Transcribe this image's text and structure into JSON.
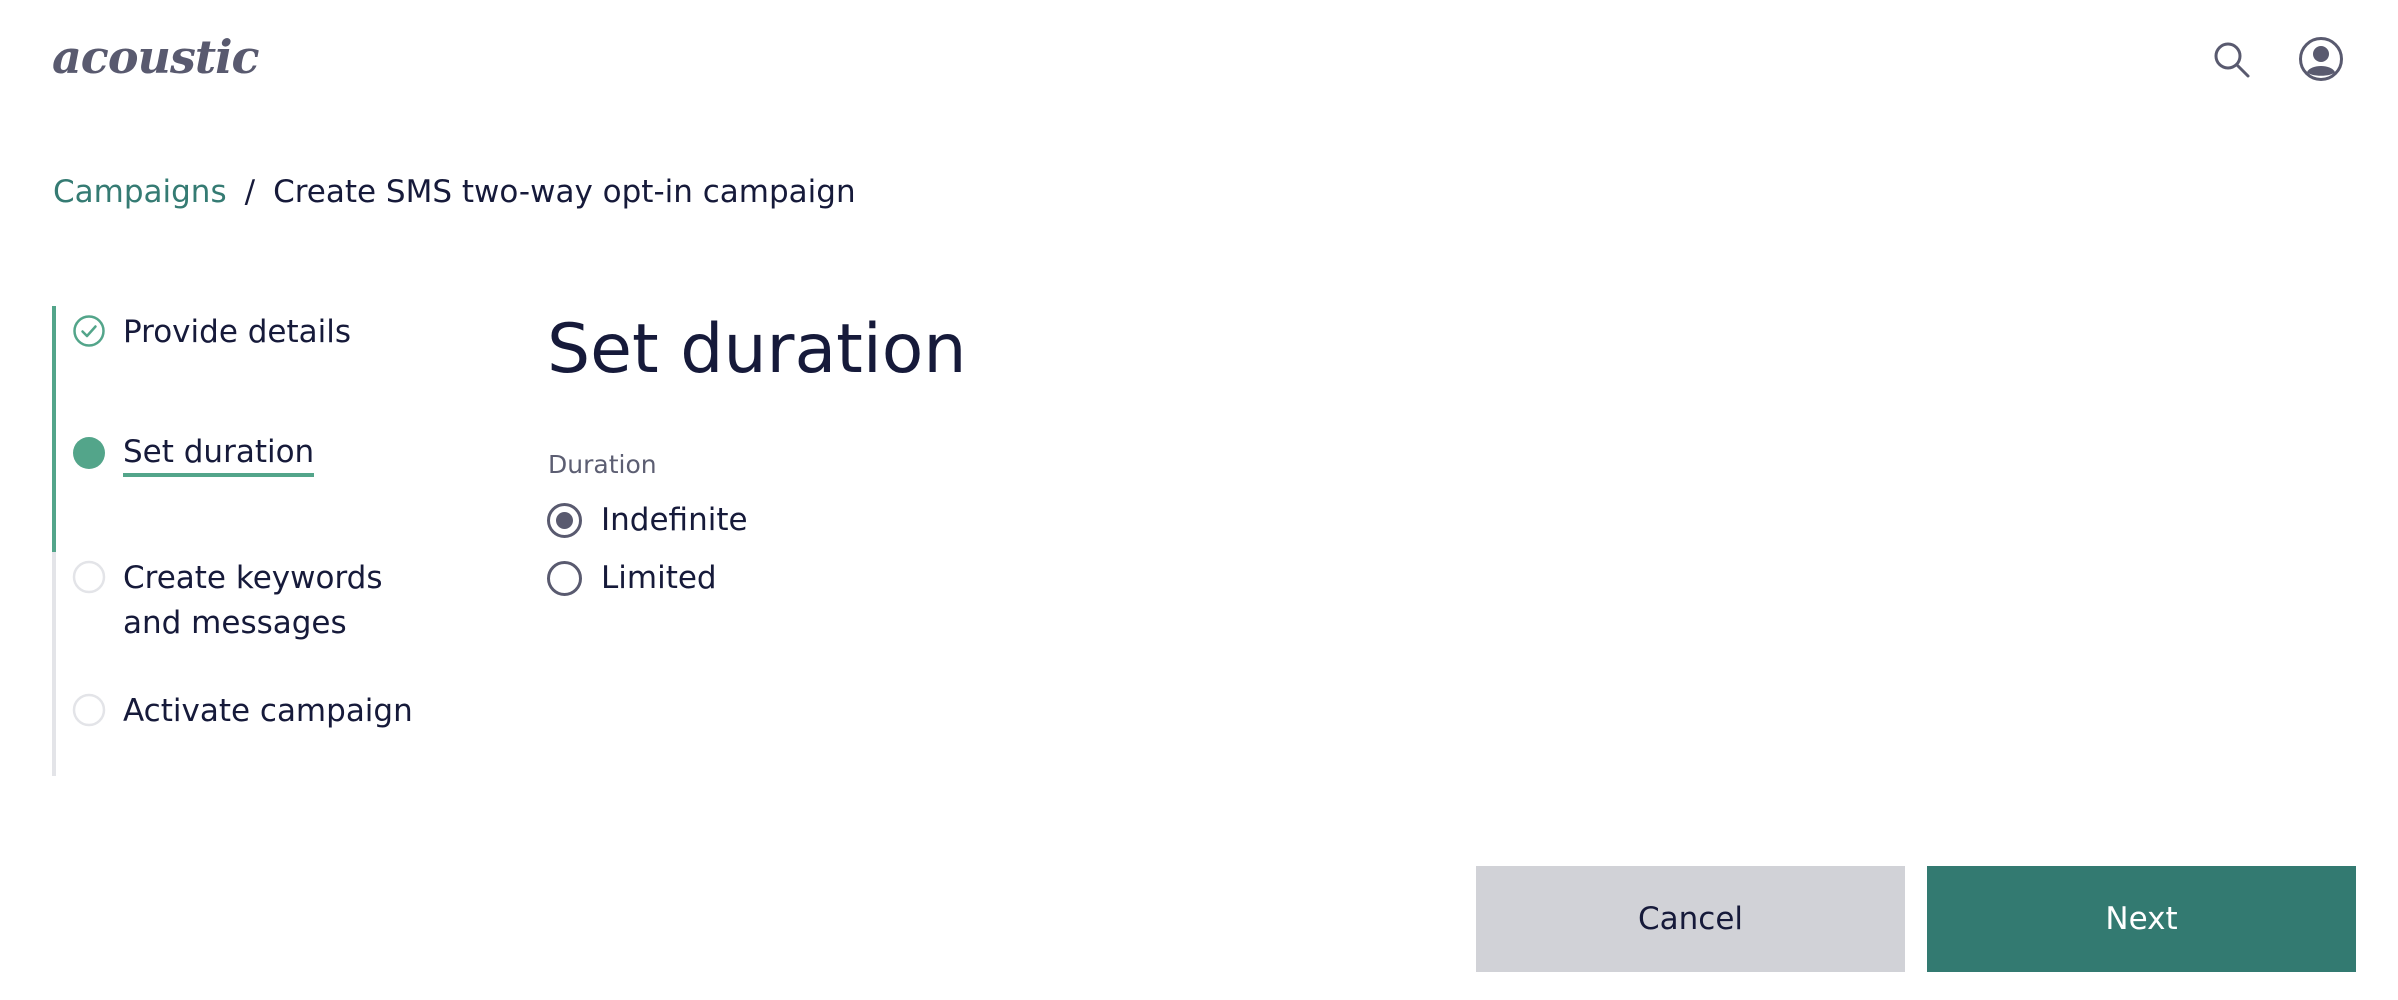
{
  "header": {
    "logo_text": "acoustic",
    "search_icon": "search-icon",
    "user_icon": "user-avatar-icon"
  },
  "breadcrumb": {
    "parent": "Campaigns",
    "separator": "/",
    "current": "Create SMS two-way opt-in campaign"
  },
  "stepper": {
    "steps": [
      {
        "label": "Provide details",
        "status": "complete",
        "icon": "check-circle-icon"
      },
      {
        "label": "Set duration",
        "status": "current",
        "icon": "filled-circle-icon"
      },
      {
        "label_line1": "Create keywords",
        "label_line2": "and messages",
        "status": "incomplete",
        "icon": "empty-circle-icon"
      },
      {
        "label": "Activate campaign",
        "status": "incomplete",
        "icon": "empty-circle-icon"
      }
    ],
    "completed_fraction": 0.5
  },
  "main": {
    "title": "Set duration",
    "duration": {
      "label": "Duration",
      "options": [
        {
          "label": "Indefinite",
          "checked": true
        },
        {
          "label": "Limited",
          "checked": false
        }
      ]
    }
  },
  "footer": {
    "cancel_label": "Cancel",
    "next_label": "Next"
  },
  "colors": {
    "accent_green": "#53a58a",
    "primary_button": "#337a71",
    "secondary_button": "#d1d2d7",
    "link": "#357b73",
    "text": "#161a3a",
    "muted": "#5c5e72"
  }
}
